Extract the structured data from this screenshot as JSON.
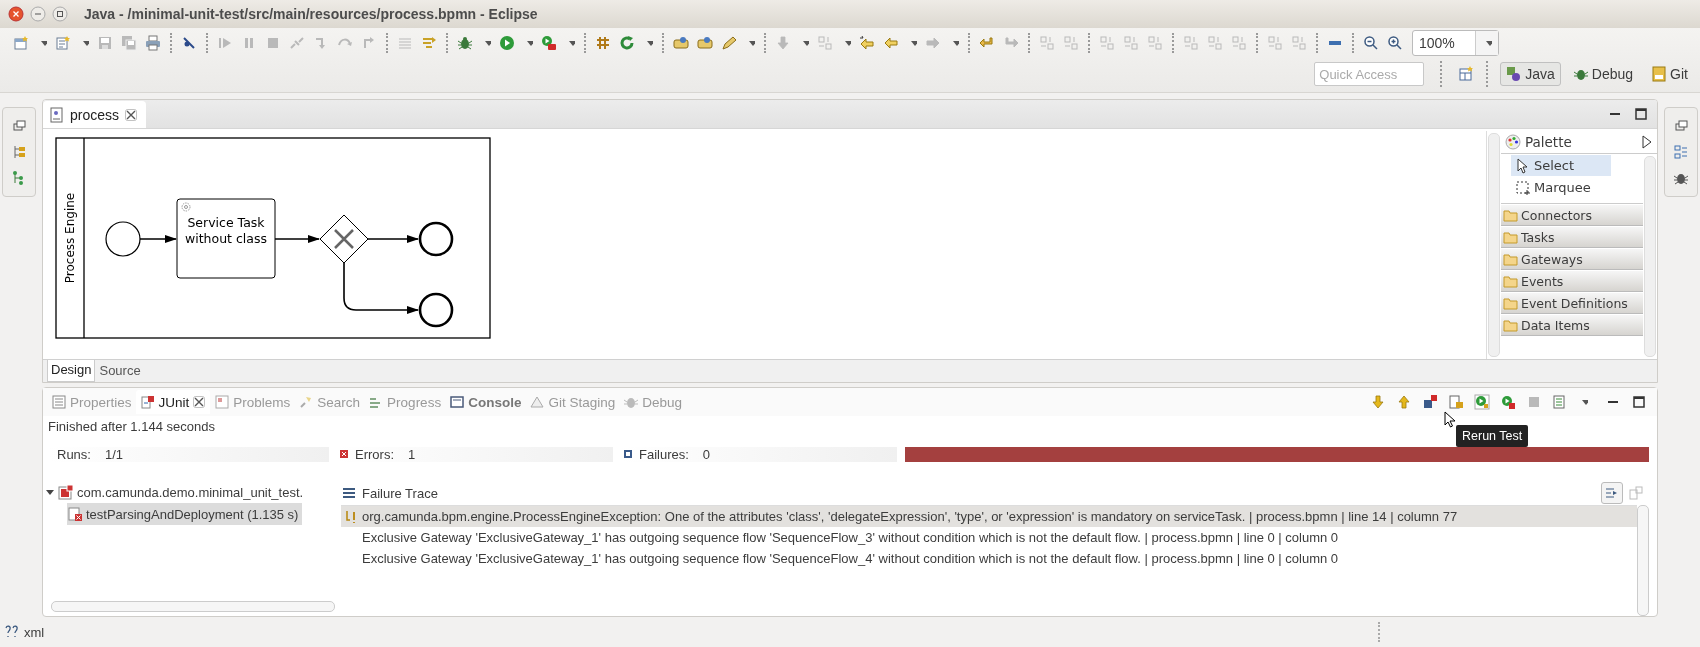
{
  "window": {
    "title": "Java - /minimal-unit-test/src/main/resources/process.bpmn - Eclipse"
  },
  "toolbar": {
    "groups": [
      [
        {
          "kind": "new",
          "disabled": false
        },
        {
          "kind": "dropdown",
          "disabled": false
        },
        {
          "kind": "wizard",
          "disabled": false
        },
        {
          "kind": "dropdown",
          "disabled": false
        },
        {
          "kind": "save",
          "disabled": true
        },
        {
          "kind": "saveall",
          "disabled": true
        },
        {
          "kind": "print",
          "disabled": false
        }
      ],
      [
        {
          "kind": "skip",
          "disabled": false
        }
      ],
      [
        {
          "kind": "resume",
          "disabled": true
        },
        {
          "kind": "suspend",
          "disabled": true
        },
        {
          "kind": "stop",
          "disabled": true
        },
        {
          "kind": "disconnect",
          "disabled": true
        },
        {
          "kind": "step",
          "disabled": true
        },
        {
          "kind": "stepover",
          "disabled": true
        },
        {
          "kind": "stepreturn",
          "disabled": true
        }
      ],
      [
        {
          "kind": "lines",
          "disabled": true
        },
        {
          "kind": "filter",
          "disabled": false
        }
      ],
      [
        {
          "kind": "debug",
          "disabled": false
        },
        {
          "kind": "dropdown",
          "disabled": false
        },
        {
          "kind": "run",
          "disabled": false
        },
        {
          "kind": "dropdown",
          "disabled": false
        },
        {
          "kind": "external",
          "disabled": false
        },
        {
          "kind": "dropdown",
          "disabled": false
        }
      ],
      [
        {
          "kind": "opentype",
          "disabled": false
        },
        {
          "kind": "refresh",
          "disabled": false
        },
        {
          "kind": "dropdown",
          "disabled": false
        }
      ],
      [
        {
          "kind": "task",
          "disabled": false
        },
        {
          "kind": "task",
          "disabled": false
        },
        {
          "kind": "pen",
          "disabled": false
        },
        {
          "kind": "dropdown",
          "disabled": false
        }
      ],
      [
        {
          "kind": "down",
          "disabled": true
        },
        {
          "kind": "dropdown",
          "disabled": false
        },
        {
          "kind": "align",
          "disabled": true
        },
        {
          "kind": "dropdown",
          "disabled": false
        },
        {
          "kind": "lastedit",
          "disabled": false
        },
        {
          "kind": "back",
          "disabled": false
        },
        {
          "kind": "dropdown",
          "disabled": false
        },
        {
          "kind": "forward",
          "disabled": true
        },
        {
          "kind": "dropdown",
          "disabled": false
        }
      ],
      [
        {
          "kind": "undo",
          "disabled": false
        },
        {
          "kind": "redo",
          "disabled": true
        }
      ],
      [
        {
          "kind": "align",
          "disabled": true
        },
        {
          "kind": "align",
          "disabled": true
        }
      ],
      [
        {
          "kind": "align",
          "disabled": true
        },
        {
          "kind": "align",
          "disabled": true
        },
        {
          "kind": "align",
          "disabled": true
        }
      ],
      [
        {
          "kind": "align",
          "disabled": true
        },
        {
          "kind": "align",
          "disabled": true
        },
        {
          "kind": "align",
          "disabled": true
        }
      ],
      [
        {
          "kind": "align",
          "disabled": true
        },
        {
          "kind": "align",
          "disabled": true
        }
      ],
      [
        {
          "kind": "collapse",
          "disabled": false
        }
      ],
      [
        {
          "kind": "zoomout",
          "disabled": false
        },
        {
          "kind": "zoomin",
          "disabled": false
        }
      ]
    ],
    "zoom": {
      "value": "100%"
    }
  },
  "quick_access": {
    "placeholder": "Quick Access"
  },
  "perspectives": [
    {
      "label": "Java",
      "selected": true
    },
    {
      "label": "Debug",
      "selected": false
    },
    {
      "label": "Git",
      "selected": false
    }
  ],
  "editor": {
    "tab": {
      "label": "process",
      "selected": true
    },
    "diagram": {
      "lane_label": "Process Engine",
      "task_label": [
        "Service Task",
        "without class"
      ]
    },
    "palette": {
      "title": "Palette",
      "tools": [
        {
          "label": "Select",
          "selected": true
        },
        {
          "label": "Marquee",
          "selected": false
        }
      ],
      "drawers": [
        "Connectors",
        "Tasks",
        "Gateways",
        "Events",
        "Event Definitions",
        "Data Items"
      ]
    },
    "pages": [
      {
        "label": "Design",
        "selected": true
      },
      {
        "label": "Source",
        "selected": false
      }
    ]
  },
  "views": {
    "tabs": [
      {
        "label": "Properties",
        "selected": false,
        "bold": false
      },
      {
        "label": "JUnit",
        "selected": true,
        "bold": false
      },
      {
        "label": "Problems",
        "selected": false,
        "bold": false
      },
      {
        "label": "Search",
        "selected": false,
        "bold": false
      },
      {
        "label": "Progress",
        "selected": false,
        "bold": false
      },
      {
        "label": "Console",
        "selected": false,
        "bold": true
      },
      {
        "label": "Git Staging",
        "selected": false,
        "bold": false
      },
      {
        "label": "Debug",
        "selected": false,
        "bold": false
      }
    ],
    "toolbar": [
      {
        "kind": "down",
        "disabled": false
      },
      {
        "kind": "up",
        "disabled": false
      },
      {
        "kind": "failonly",
        "disabled": false
      },
      {
        "kind": "scrolllock",
        "disabled": false
      },
      {
        "kind": "rerun",
        "disabled": false
      },
      {
        "kind": "rerunfail",
        "disabled": false
      },
      {
        "kind": "stop",
        "disabled": true
      },
      {
        "kind": "history",
        "disabled": false
      },
      {
        "kind": "dropdown",
        "disabled": false
      }
    ],
    "tooltip": "Rerun Test"
  },
  "junit": {
    "status": "Finished after 1.144 seconds",
    "counters": [
      {
        "label": "Runs:",
        "value": "1/1",
        "kind": "runs"
      },
      {
        "label": "Errors:",
        "value": "1",
        "kind": "errors"
      },
      {
        "label": "Failures:",
        "value": "0",
        "kind": "failures"
      }
    ],
    "progress": {
      "level": 1,
      "color": "#a4403f"
    },
    "tree": [
      {
        "label": "com.camunda.demo.minimal_unit_test.",
        "expanded": true,
        "selected": false,
        "children": [
          {
            "label": "testParsingAndDeployment (1.135 s)",
            "selected": true
          }
        ]
      }
    ],
    "trace_title": "Failure Trace",
    "trace": [
      {
        "text": "org.camunda.bpm.engine.ProcessEngineException: One of the attributes 'class', 'delegateExpression', 'type', or 'expression' is mandatory on serviceTask. | process.bpmn | line 14 | column 77",
        "selected": true
      },
      {
        "text": "Exclusive Gateway 'ExclusiveGateway_1' has outgoing sequence flow 'SequenceFlow_3' without condition which is not the default flow. | process.bpmn | line 0 | column 0",
        "selected": false
      },
      {
        "text": "Exclusive Gateway 'ExclusiveGateway_1' has outgoing sequence flow 'SequenceFlow_4' without condition which is not the default flow. | process.bpmn | line 0 | column 0",
        "selected": false
      }
    ]
  },
  "status_bar": {
    "text": "xml"
  }
}
